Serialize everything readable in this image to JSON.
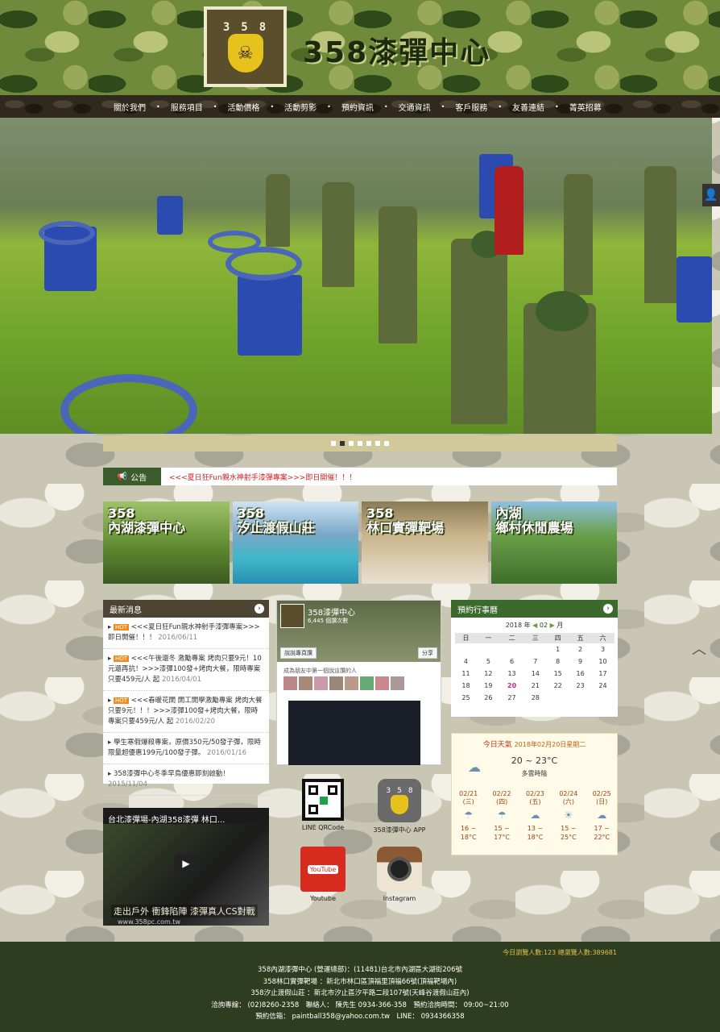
{
  "header": {
    "logo_digits": "358",
    "title": "358漆彈中心"
  },
  "nav": {
    "items": [
      "關於我們",
      "服務項目",
      "活動價格",
      "活動剪影",
      "預約資訊",
      "交通資訊",
      "客戶服務",
      "友善連結",
      "菁英招募"
    ]
  },
  "slider": {
    "count": 7,
    "active_index": 1
  },
  "notice": {
    "label": "公告",
    "text": "<<<夏日狂Fun親水神射手漆彈專案>>>即日開催！！！"
  },
  "banners": [
    {
      "title": "358\n內湖漆彈中心"
    },
    {
      "title": "358\n汐止渡假山莊"
    },
    {
      "title": "358\n林口實彈靶場"
    },
    {
      "title": "內湖\n鄉村休閒農場"
    }
  ],
  "news": {
    "title": "最新消息",
    "items": [
      {
        "hot": "HOT",
        "text": "<<<夏日狂Fun親水神射手漆彈專案>>>即日開催！！！",
        "date": "2016/06/11"
      },
      {
        "hot": "HOT",
        "text": "<<<午後還冬 激勵專案 烤肉只要9元！10元還再抗！>>>漆彈100發+烤肉大餐，限時專案只要459元/人 起",
        "date": "2016/04/01"
      },
      {
        "hot": "HOT",
        "text": "<<<春暖花開 開工開學激勵專案 烤肉大餐只要9元！！！>>>漆彈100發+烤肉大餐，限時專案只要459元/人 起",
        "date": "2016/02/20"
      },
      {
        "hot": "",
        "text": "學生寒假爆殺專案，原價350元/50發子彈，限時限量超優惠199元/100發子彈。",
        "date": "2016/01/16"
      },
      {
        "hot": "",
        "text": "358漆彈中心冬季早鳥優惠即刻啟動！",
        "date": "2015/11/04"
      }
    ]
  },
  "facebook": {
    "page_name": "358漆彈中心",
    "likes": "6,445 個讚次數",
    "like_button": "說說專頁讚",
    "share_button": "分享",
    "friends_text": "成為朋友中第一個說這讚的人"
  },
  "icons": {
    "line_label": "LINE QRCode",
    "app_label": "358漆彈中心 APP",
    "youtube_label": "Youtube",
    "youtube_logo_text": "YouTube",
    "instagram_label": "Instagram"
  },
  "calendar": {
    "title": "預約行事曆",
    "year": "2018 年",
    "month": "02",
    "month_suffix": "月",
    "weekdays": [
      "日",
      "一",
      "二",
      "三",
      "四",
      "五",
      "六"
    ],
    "weeks": [
      [
        "",
        "",
        "",
        "",
        "1",
        "2",
        "3"
      ],
      [
        "4",
        "5",
        "6",
        "7",
        "8",
        "9",
        "10"
      ],
      [
        "11",
        "12",
        "13",
        "14",
        "15",
        "16",
        "17"
      ],
      [
        "18",
        "19",
        "20",
        "21",
        "22",
        "23",
        "24"
      ],
      [
        "25",
        "26",
        "27",
        "28",
        "",
        "",
        ""
      ]
    ],
    "highlight": "20",
    "highlight_color": "#e0207a"
  },
  "weather": {
    "title": "今日天氣",
    "date": "2018年02月20日星期二",
    "temp": "20 ~ 23°C",
    "condition": "多雲時陰",
    "days": [
      {
        "date": "02/21",
        "dow": "(三)",
        "range": "16 ~\n18°C"
      },
      {
        "date": "02/22",
        "dow": "(四)",
        "range": "15 ~\n17°C"
      },
      {
        "date": "02/23",
        "dow": "(五)",
        "range": "13 ~\n18°C"
      },
      {
        "date": "02/24",
        "dow": "(六)",
        "range": "15 ~\n25°C"
      },
      {
        "date": "02/25",
        "dow": "(日)",
        "range": "17 ~\n22°C"
      }
    ]
  },
  "video": {
    "title": "台北漆彈場-內湖358漆彈 林口...",
    "caption": "走出戶外 衝鋒陷陣 漆彈真人CS對戰",
    "url": "www.358pc.com.tw"
  },
  "footer": {
    "count_text": "今日瀏覽人數:123  總瀏覽人數:389681",
    "lines": [
      "358內湖漆彈中心 (營運總部)：(11481)台北市內湖區大湖街206號",
      "358林口實彈靶場 ：新北市林口區頂福里頂福66號(頂福靶場內)",
      "358汐止渡假山莊 ：新北市汐止區汐平路二段107號(天峰谷渡假山莊內)",
      "洽詢專線： (02)8260-2358　聯絡人： 陳先生 0934-366-358　預約洽詢時間： 09:00~21:00",
      "預約信箱： paintball358@yahoo.com.tw　LINE： 0934366358"
    ]
  },
  "colors": {
    "nav_bg": "#2f2a1d",
    "panel_head": "#4d4532",
    "calendar_head": "#3c6a2d",
    "footer_bg": "#2e3d1f",
    "notice_text": "#d02020"
  }
}
